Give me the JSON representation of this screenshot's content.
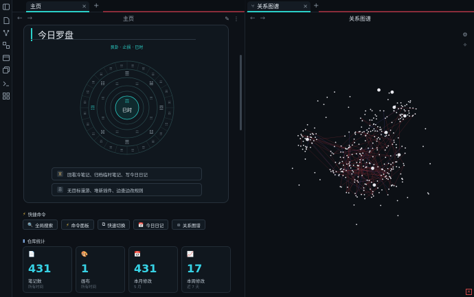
{
  "tabs": {
    "left": {
      "label": "主页"
    },
    "right": {
      "label": "关系图谱"
    }
  },
  "nav": {
    "left_title": "主页",
    "right_title": "关系图谱"
  },
  "compass_card": {
    "title": "今日罗盘",
    "subtitle": "艮卦 · 止损 · 巳时",
    "center_label": "巳时",
    "hints": [
      {
        "badge": "宜",
        "text": "回看冷笔记、归档临时笔记、写今日日记"
      },
      {
        "badge": "忌",
        "text": "无目标漫游、堆新插件、边查边改规则"
      }
    ]
  },
  "quick_commands": {
    "heading": "快捷命令",
    "items": [
      {
        "icon": "🔍",
        "label": "全局搜索"
      },
      {
        "icon": "⚡",
        "label": "命令面板"
      },
      {
        "icon": "⧉",
        "label": "快速切换"
      },
      {
        "icon": "📅",
        "label": "今日日记"
      },
      {
        "icon": "⊛",
        "label": "关系图谱"
      }
    ]
  },
  "vault_stats": {
    "heading": "仓库统计",
    "cards": [
      {
        "icon": "📄",
        "value": "431",
        "label": "笔记数",
        "sub": "所有时间"
      },
      {
        "icon": "🎨",
        "value": "1",
        "label": "画布",
        "sub": "所有时间"
      },
      {
        "icon": "📅",
        "value": "431",
        "label": "本月修改",
        "sub": "5 月"
      },
      {
        "icon": "📈",
        "value": "17",
        "label": "本周修改",
        "sub": "近 7 天"
      }
    ]
  },
  "colors": {
    "accent": "#2bd1c9",
    "number": "#37d3e6",
    "graph_node": "#e8e8ee",
    "graph_edge": "#7a2a32"
  }
}
